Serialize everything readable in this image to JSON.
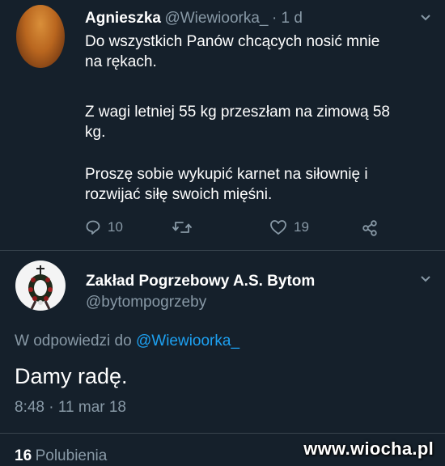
{
  "tweet": {
    "author_name": "Agnieszka",
    "author_handle": "@Wiewioorka_",
    "time": "· 1 d",
    "paragraphs": [
      [
        "Do wszystkich Panów chcących nosić mnie",
        "na rękach."
      ],
      [
        "Z wagi letniej 55 kg przeszłam na zimową 58",
        "kg."
      ],
      [
        "Proszę sobie wykupić karnet na siłownię i",
        "rozwijać siłę swoich mięśni."
      ]
    ],
    "actions": {
      "reply_count": "10",
      "like_count": "19"
    }
  },
  "reply": {
    "author_name": "Zakład Pogrzebowy A.S. Bytom",
    "author_handle": "@bytompogrzeby",
    "in_reply_prefix": "W odpowiedzi do ",
    "in_reply_mention": "@Wiewioorka_",
    "text": "Damy radę.",
    "timestamp": "8:48 · 11 mar 18",
    "likes_count": "16",
    "likes_label": "Polubienia"
  },
  "watermark": "www.wiocha.pl",
  "icons": {
    "reply": "reply-icon",
    "retweet": "retweet-icon",
    "like": "heart-icon",
    "share": "share-icon",
    "more": "chevron-down-icon"
  },
  "colors": {
    "background": "#15202b",
    "secondary_text": "#8899a6",
    "link": "#1da1f2"
  }
}
